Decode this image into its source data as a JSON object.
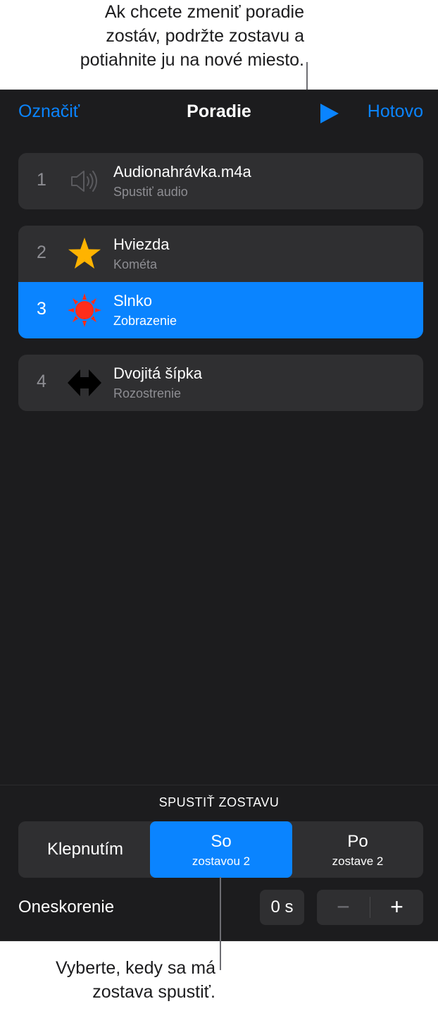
{
  "callouts": {
    "top": "Ak chcete zmeniť poradie\nzostáv, podržte zostavu a\npotiahnite ju na nové miesto.",
    "bottom": "Vyberte, kedy sa má\nzostava spustiť."
  },
  "nav": {
    "left_label": "Označiť",
    "title": "Poradie",
    "play_icon": "play-icon",
    "done_label": "Hotovo"
  },
  "builds": [
    {
      "number": "1",
      "title": "Audionahrávka.m4a",
      "subtitle": "Spustiť audio",
      "icon": "speaker-icon",
      "selected": false
    },
    {
      "number": "2",
      "title": "Hviezda",
      "subtitle": "Kométa",
      "icon": "star-icon",
      "selected": false
    },
    {
      "number": "3",
      "title": "Slnko",
      "subtitle": "Zobrazenie",
      "icon": "sun-icon",
      "selected": true
    },
    {
      "number": "4",
      "title": "Dvojitá šípka",
      "subtitle": "Rozostrenie",
      "icon": "double-arrow-icon",
      "selected": false
    }
  ],
  "start_build": {
    "section_label": "SPUSTIŤ ZOSTAVU",
    "options": [
      {
        "main": "Klepnutím",
        "sub": "",
        "selected": false
      },
      {
        "main": "So",
        "sub": "zostavou 2",
        "selected": true
      },
      {
        "main": "Po",
        "sub": "zostave 2",
        "selected": false
      }
    ]
  },
  "delay": {
    "label": "Oneskorenie",
    "value": "0 s",
    "minus": "−",
    "plus": "+"
  },
  "colors": {
    "accent": "#0a84ff",
    "panel_bg": "#1c1c1e",
    "row_bg": "#2f2f31",
    "star": "#ffb300",
    "sun": "#ff2d1a"
  }
}
